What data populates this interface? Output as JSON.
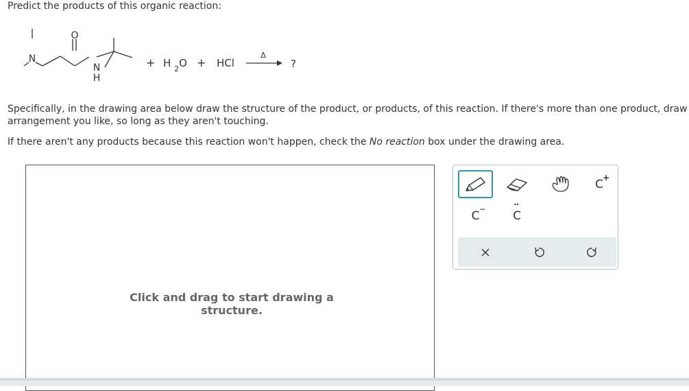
{
  "question": {
    "prompt": "Predict the products of this organic reaction:",
    "reaction": {
      "reagent_1": "H2O",
      "reagent_2": "HCl",
      "plus_1": "+",
      "plus_2": "+",
      "plus_3": "+",
      "condition": "Δ",
      "product": "?",
      "atom_n_top": "N",
      "atom_o": "O",
      "atom_n_bottom": "N",
      "atom_h": "H"
    },
    "instructions_1a": "Specifically, in the drawing area below draw the structure of the product, or products, of this reaction. If there's more than one product, draw",
    "instructions_1b": "arrangement you like, so long as they aren't touching.",
    "instructions_2_pre": "If there aren't any products because this reaction won't happen, check the ",
    "instructions_2_em": "No reaction",
    "instructions_2_post": " box under the drawing area."
  },
  "canvas": {
    "hint_line_1": "Click and drag to start drawing a",
    "hint_line_2": "structure."
  },
  "toolbar": {
    "c_plus_label": "C",
    "c_plus_sup": "+",
    "c_minus_label": "C",
    "c_minus_sup": "−",
    "c_lone_pair_label": "C",
    "c_lone_pair_dots": "••",
    "icons": [
      "pencil-icon",
      "eraser-icon",
      "hand-icon",
      "carbocation-icon",
      "carbanion-icon",
      "lone-pair-icon",
      "clear-icon",
      "undo-icon",
      "redo-icon"
    ],
    "accent_color": "#2f93b6"
  }
}
